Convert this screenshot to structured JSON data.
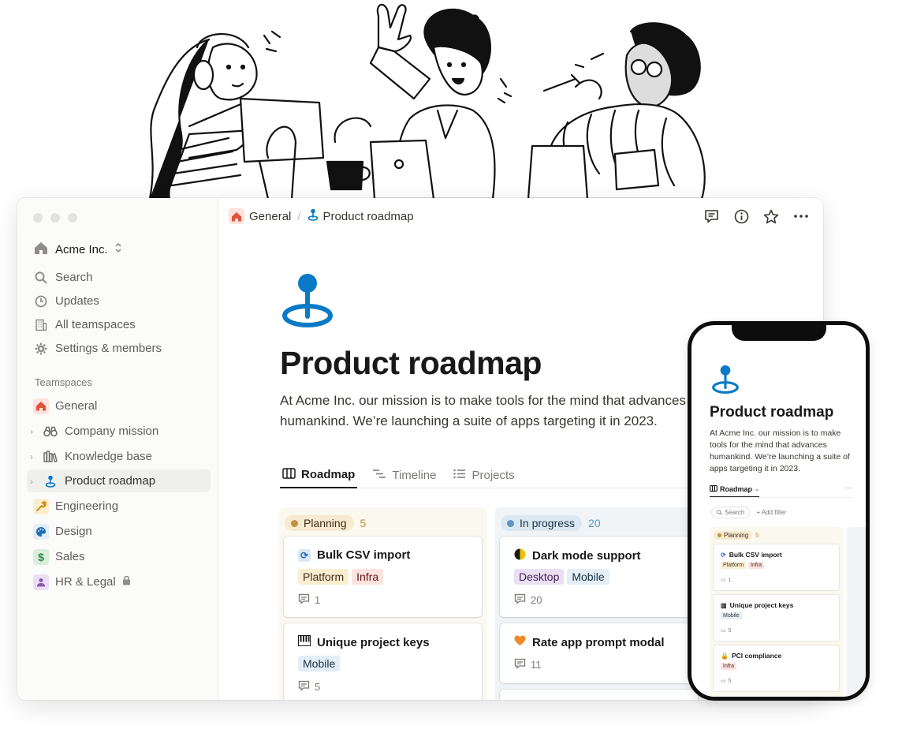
{
  "window": {
    "workspace_name": "Acme Inc.",
    "nav": [
      "Search",
      "Updates",
      "All teamspaces",
      "Settings & members"
    ],
    "teamspaces_label": "Teamspaces",
    "teamspaces": [
      "General",
      "Company mission",
      "Knowledge base",
      "Product roadmap",
      "Engineering",
      "Design",
      "Sales",
      "HR & Legal"
    ]
  },
  "breadcrumb": {
    "parent": "General",
    "current": "Product roadmap"
  },
  "page": {
    "title": "Product roadmap",
    "description": "At Acme Inc. our mission is to make tools for the mind that advances humankind. We’re launching a suite of apps targeting it in 2023."
  },
  "tabs": [
    "Roadmap",
    "Timeline",
    "Projects"
  ],
  "board": {
    "columns": [
      {
        "name": "Planning",
        "count": "5",
        "cards": [
          {
            "title": "Bulk CSV import",
            "tags": [
              "Platform",
              "Infra"
            ],
            "comments": "1"
          },
          {
            "title": "Unique project keys",
            "tags": [
              "Mobile"
            ],
            "comments": "5"
          }
        ]
      },
      {
        "name": "In progress",
        "count": "20",
        "cards": [
          {
            "title": "Dark mode support",
            "tags": [
              "Desktop",
              "Mobile"
            ],
            "comments": "20"
          },
          {
            "title": "Rate app prompt modal",
            "tags": [],
            "comments": "11"
          }
        ]
      }
    ]
  },
  "phone": {
    "title": "Product roadmap",
    "description": "At Acme Inc. our mission is to make tools for the mind that advances humankind. We’re launching a suite of apps targeting it in 2023.",
    "tab": "Roadmap",
    "more": "···",
    "search": "Search",
    "add_filter": "+ Add filter",
    "column": {
      "name": "Planning",
      "count": "5"
    },
    "cards": [
      {
        "title": "Bulk CSV import",
        "tags": [
          "Platform",
          "Infra"
        ],
        "comments": "1"
      },
      {
        "title": "Unique project keys",
        "tags": [
          "Mobile"
        ],
        "comments": "5"
      },
      {
        "title": "PCI compliance",
        "tags": [
          "Infra"
        ],
        "comments": "5"
      }
    ]
  },
  "colors": {
    "planning_bg": "#fbf8ef",
    "in_progress_bg": "#f0f4f7",
    "accent_blue": "#0b7ac6",
    "tag_platform": "#fbeecf",
    "tag_infra": "#fde2dd",
    "tag_mobile": "#e3eef7",
    "tag_desktop": "#ebdff4"
  },
  "icons": {
    "page": "map-pin-icon",
    "general": "house-icon",
    "company_mission": "binoculars-icon",
    "knowledge_base": "books-icon",
    "engineering": "wrench-icon",
    "design": "palette-icon",
    "sales": "dollar-icon",
    "hr_legal": "person-icon"
  }
}
